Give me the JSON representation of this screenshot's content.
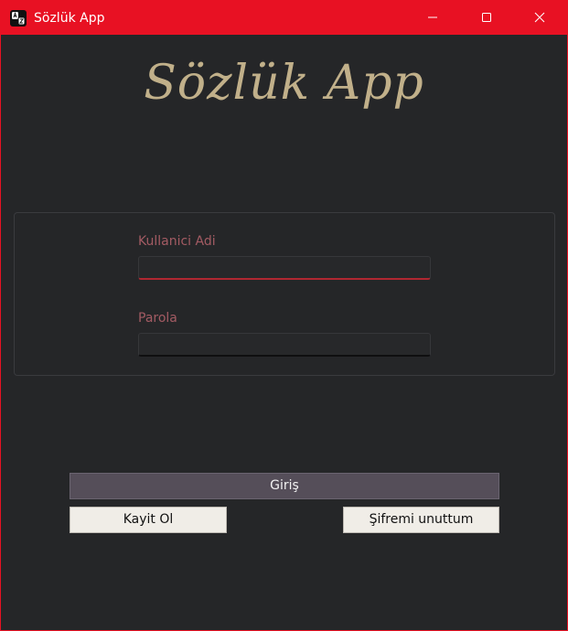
{
  "window": {
    "title": "Sözlük App",
    "app_icon": "dictionary-app-icon",
    "controls": {
      "minimize_icon": "minimize-icon",
      "maximize_icon": "maximize-icon",
      "close_icon": "close-icon"
    },
    "titlebar_color": "#e81123",
    "background_color": "#252628"
  },
  "header": {
    "heading": "Sözlük App",
    "heading_color": "#c1b08a"
  },
  "login_form": {
    "username_label": "Kullanici Adi",
    "username_value": "",
    "password_label": "Parola",
    "password_value": "",
    "label_color": "#a35b63",
    "focus_accent": "#b02731"
  },
  "actions": {
    "login_label": "Giriş",
    "register_label": "Kayit Ol",
    "forgot_label": "Şifremi unuttum"
  }
}
